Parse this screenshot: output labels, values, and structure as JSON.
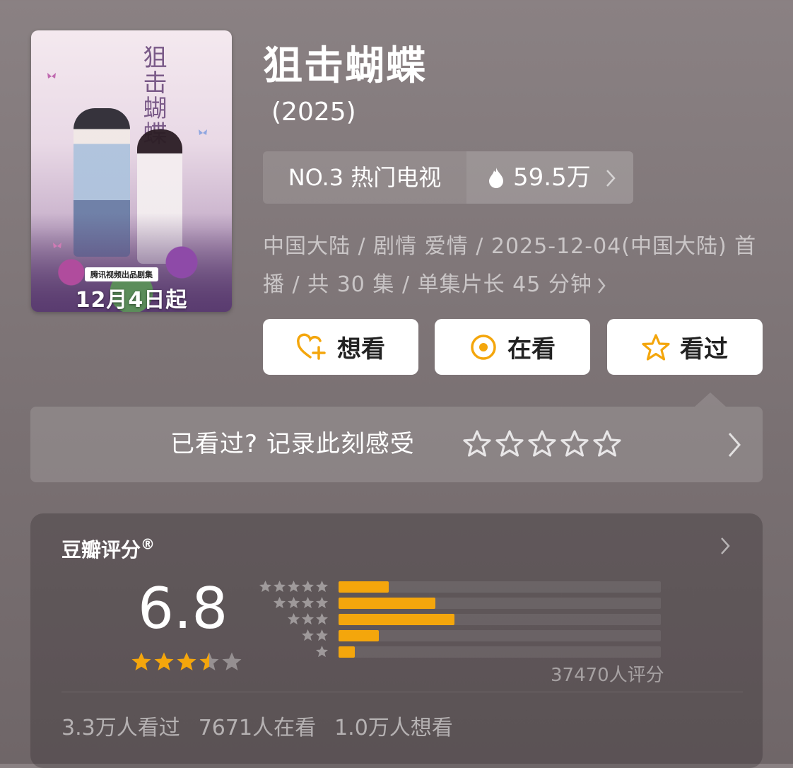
{
  "header": {
    "title": "狙击蝴蝶",
    "year": "(2025)",
    "poster": {
      "calligraphy": "狙击蝴蝶",
      "tag": "腾讯视频出品剧集",
      "date_banner": "12月4日起"
    }
  },
  "rank": {
    "label": "NO.3 热门电视",
    "heat": "59.5万",
    "heat_icon": "flame-icon"
  },
  "meta": {
    "line1": "中国大陆 / 剧情 爱情 / 2025-12-04(中国大陆) 首",
    "line2": "播 / 共 30 集 / 单集片长 45 分钟"
  },
  "actions": {
    "want": "想看",
    "watching": "在看",
    "watched": "看过",
    "accent_color": "#f4a60c"
  },
  "record": {
    "prompt": "已看过? 记录此刻感受",
    "star_count": 5
  },
  "rating": {
    "label": "豆瓣评分",
    "mark": "®",
    "score": "6.8",
    "stars_value": 3.5,
    "distribution": [
      {
        "stars": 5,
        "fraction": 0.155
      },
      {
        "stars": 4,
        "fraction": 0.3
      },
      {
        "stars": 3,
        "fraction": 0.36
      },
      {
        "stars": 2,
        "fraction": 0.125
      },
      {
        "stars": 1,
        "fraction": 0.05
      }
    ],
    "count_text": "37470人评分",
    "stats": {
      "watched": "3.3万人看过",
      "watching": "7671人在看",
      "want": "1.0万人想看"
    }
  }
}
